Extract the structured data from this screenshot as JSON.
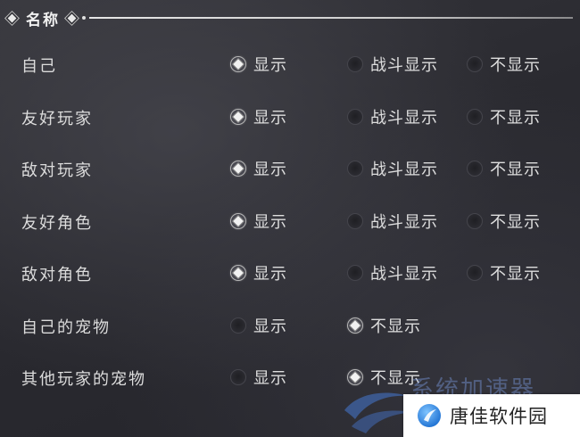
{
  "section": {
    "title": "名称"
  },
  "rows": [
    {
      "label": "自己",
      "options": [
        {
          "label": "显示",
          "selected": true
        },
        {
          "label": "战斗显示",
          "selected": false
        },
        {
          "label": "不显示",
          "selected": false
        }
      ]
    },
    {
      "label": "友好玩家",
      "options": [
        {
          "label": "显示",
          "selected": true
        },
        {
          "label": "战斗显示",
          "selected": false
        },
        {
          "label": "不显示",
          "selected": false
        }
      ]
    },
    {
      "label": "敌对玩家",
      "options": [
        {
          "label": "显示",
          "selected": true
        },
        {
          "label": "战斗显示",
          "selected": false
        },
        {
          "label": "不显示",
          "selected": false
        }
      ]
    },
    {
      "label": "友好角色",
      "options": [
        {
          "label": "显示",
          "selected": true
        },
        {
          "label": "战斗显示",
          "selected": false
        },
        {
          "label": "不显示",
          "selected": false
        }
      ]
    },
    {
      "label": "敌对角色",
      "options": [
        {
          "label": "显示",
          "selected": true
        },
        {
          "label": "战斗显示",
          "selected": false
        },
        {
          "label": "不显示",
          "selected": false
        }
      ]
    },
    {
      "label": "自己的宠物",
      "options": [
        {
          "label": "显示",
          "selected": false
        },
        {
          "label": "不显示",
          "selected": true
        }
      ]
    },
    {
      "label": "其他玩家的宠物",
      "options": [
        {
          "label": "显示",
          "selected": false
        },
        {
          "label": "不显示",
          "selected": true
        }
      ]
    }
  ],
  "watermark": {
    "faded_text": "系统加速器",
    "brand_text": "唐佳软件园"
  },
  "colors": {
    "background": "#2c2c32",
    "text": "#dcdcdc",
    "header_line": "#e6e6e6",
    "watermark_blue": "#2e7fd9"
  }
}
